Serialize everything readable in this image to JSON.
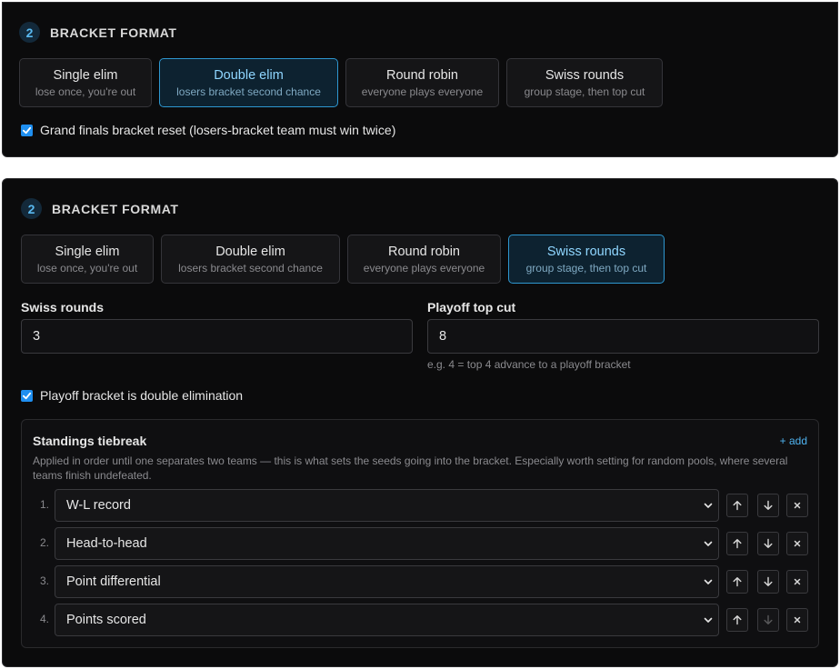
{
  "panel_a": {
    "step_number": "2",
    "section_title": "BRACKET FORMAT",
    "formats": [
      {
        "name": "Single elim",
        "desc": "lose once, you're out"
      },
      {
        "name": "Double elim",
        "desc": "losers bracket second chance"
      },
      {
        "name": "Round robin",
        "desc": "everyone plays everyone"
      },
      {
        "name": "Swiss rounds",
        "desc": "group stage, then top cut"
      }
    ],
    "selected_format": "Double elim",
    "grand_finals_reset_label": "Grand finals bracket reset (losers-bracket team must win twice)",
    "grand_finals_reset_checked": true
  },
  "panel_b": {
    "step_number": "2",
    "section_title": "BRACKET FORMAT",
    "formats": [
      {
        "name": "Single elim",
        "desc": "lose once, you're out"
      },
      {
        "name": "Double elim",
        "desc": "losers bracket second chance"
      },
      {
        "name": "Round robin",
        "desc": "everyone plays everyone"
      },
      {
        "name": "Swiss rounds",
        "desc": "group stage, then top cut"
      }
    ],
    "selected_format": "Swiss rounds",
    "swiss_rounds_label": "Swiss rounds",
    "swiss_rounds_value": "3",
    "top_cut_label": "Playoff top cut",
    "top_cut_value": "8",
    "top_cut_hint": "e.g. 4 = top 4 advance to a playoff bracket",
    "playoff_double_label": "Playoff bracket is double elimination",
    "playoff_double_checked": true,
    "tiebreak": {
      "title": "Standings tiebreak",
      "add_label": "+ add",
      "description": "Applied in order until one separates two teams — this is what sets the seeds going into the bracket. Especially worth setting for random pools, where several teams finish undefeated.",
      "rules": [
        {
          "num": "1.",
          "value": "W-L record"
        },
        {
          "num": "2.",
          "value": "Head-to-head"
        },
        {
          "num": "3.",
          "value": "Point differential"
        },
        {
          "num": "4.",
          "value": "Points scored"
        }
      ]
    }
  },
  "colors": {
    "background": "#0b0b0c",
    "accent": "#2e97d0",
    "checkbox": "#1f8ff0",
    "link": "#4fb3f0"
  },
  "icons": [
    "checkbox-check-icon",
    "chevron-down-icon",
    "arrow-up-icon",
    "arrow-down-icon",
    "close-icon"
  ]
}
